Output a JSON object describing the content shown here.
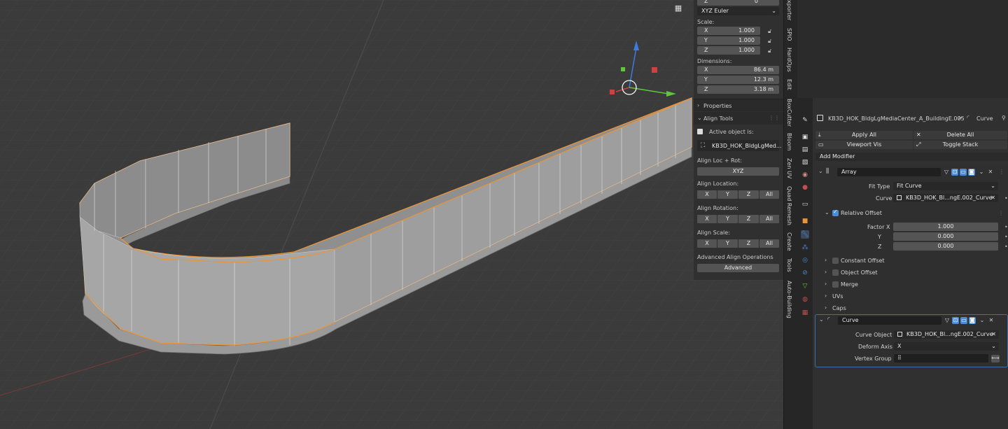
{
  "npanel": {
    "rotation_mode": "XYZ Euler",
    "scale_label": "Scale:",
    "scale": {
      "x_key": "X",
      "x": "1.000",
      "y_key": "Y",
      "y": "1.000",
      "z_key": "Z",
      "z": "1.000"
    },
    "dimensions_label": "Dimensions:",
    "dimensions": {
      "x_key": "X",
      "x": "86.4 m",
      "y_key": "Y",
      "y": "12.3 m",
      "z_key": "Z",
      "z": "3.18 m"
    },
    "top_z_key": "Z",
    "top_z": "0",
    "properties_header": "Properties",
    "align_tools_header": "Align Tools",
    "active_object_label": "Active object is:",
    "active_object_value": "KB3D_HOK_BldgLgMed...",
    "align_loc_rot_label": "Align Loc + Rot:",
    "align_loc_rot_btn": "XYZ",
    "align_location_label": "Align Location:",
    "align_rotation_label": "Align Rotation:",
    "align_scale_label": "Align Scale:",
    "axis_buttons": [
      "X",
      "Y",
      "Z",
      "All"
    ],
    "advanced_label": "Advanced Align Operations",
    "advanced_btn": "Advanced"
  },
  "vtabs": [
    "xporter",
    "SPIO",
    "HardOps",
    "Edit",
    "BoxCutter",
    "Bloom",
    "Zen UV",
    "Quad Remesh",
    "Create",
    "Tools",
    "Auto-Building"
  ],
  "props": {
    "object_name": "KB3D_HOK_BldgLgMediaCenter_A_BuildingE.005",
    "breadcrumb_sep": ">",
    "modifier_target": "Curve",
    "apply_all": "Apply All",
    "delete_all": "Delete All",
    "viewport_vis": "Viewport Vis",
    "toggle_stack": "Toggle Stack",
    "add_modifier": "Add Modifier",
    "array": {
      "name": "Array",
      "fit_type_label": "Fit Type",
      "fit_type": "Fit Curve",
      "curve_label": "Curve",
      "curve": "KB3D_HOK_Bl...ngE.002_Curve",
      "relative_offset": "Relative Offset",
      "factor_x_label": "Factor X",
      "factor_x": "1.000",
      "y_label": "Y",
      "y": "0.000",
      "z_label": "Z",
      "z": "0.000",
      "constant_offset": "Constant Offset",
      "object_offset": "Object Offset",
      "merge": "Merge",
      "uvs": "UVs",
      "caps": "Caps"
    },
    "curve_mod": {
      "name": "Curve",
      "curve_object_label": "Curve Object",
      "curve_object": "KB3D_HOK_Bl...ngE.002_Curve",
      "deform_axis_label": "Deform Axis",
      "deform_axis": "X",
      "vertex_group_label": "Vertex Group"
    }
  },
  "colors": {
    "accent": "#4a8bd3",
    "selection": "#e8953a",
    "viewport": "#3b3b3b",
    "panel": "#303030"
  }
}
